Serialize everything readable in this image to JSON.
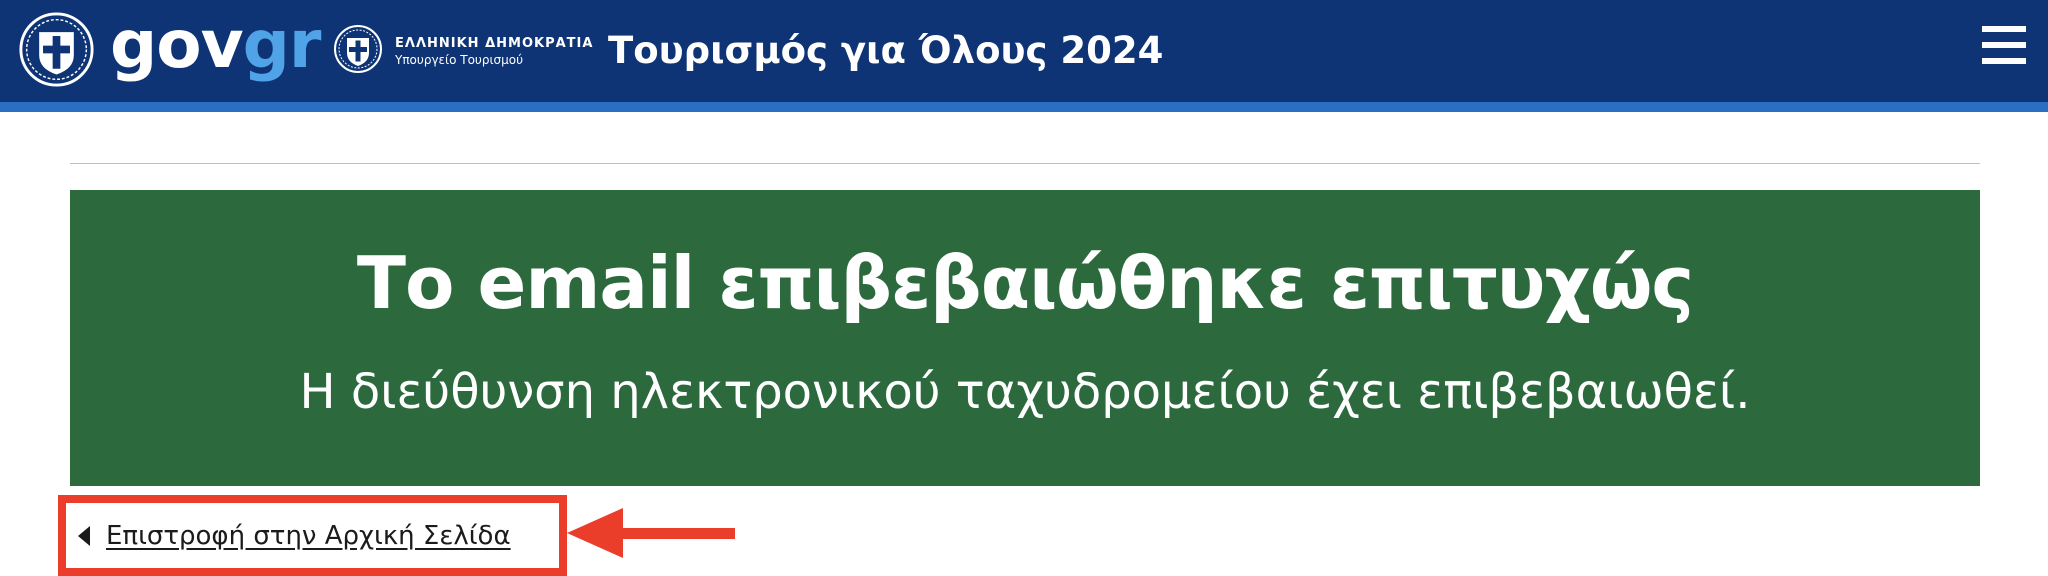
{
  "header": {
    "brand_gov": "gov",
    "brand_gr": "gr",
    "ministry_line1": "ΕΛΛΗΝΙΚΗ ΔΗΜΟΚΡΑΤΙΑ",
    "ministry_line2": "Υπουργείο Τουρισμού",
    "site_title": "Τουρισμός για Όλους 2024",
    "menu_icon": "hamburger-menu-icon"
  },
  "main": {
    "success_title": "Το email επιβεβαιώθηκε επιτυχώς",
    "success_message": "Η διεύθυνση ηλεκτρονικού ταχυδρομείου έχει επιβεβαιωθεί.",
    "back_link_label": "Επιστροφή στην Αρχική Σελίδα"
  },
  "colors": {
    "header_bg": "#0f3476",
    "header_stripe": "#2a6fc4",
    "brand_accent": "#4fa3e6",
    "success_bg": "#2c6a3e",
    "annotation": "#ea3d2a"
  }
}
